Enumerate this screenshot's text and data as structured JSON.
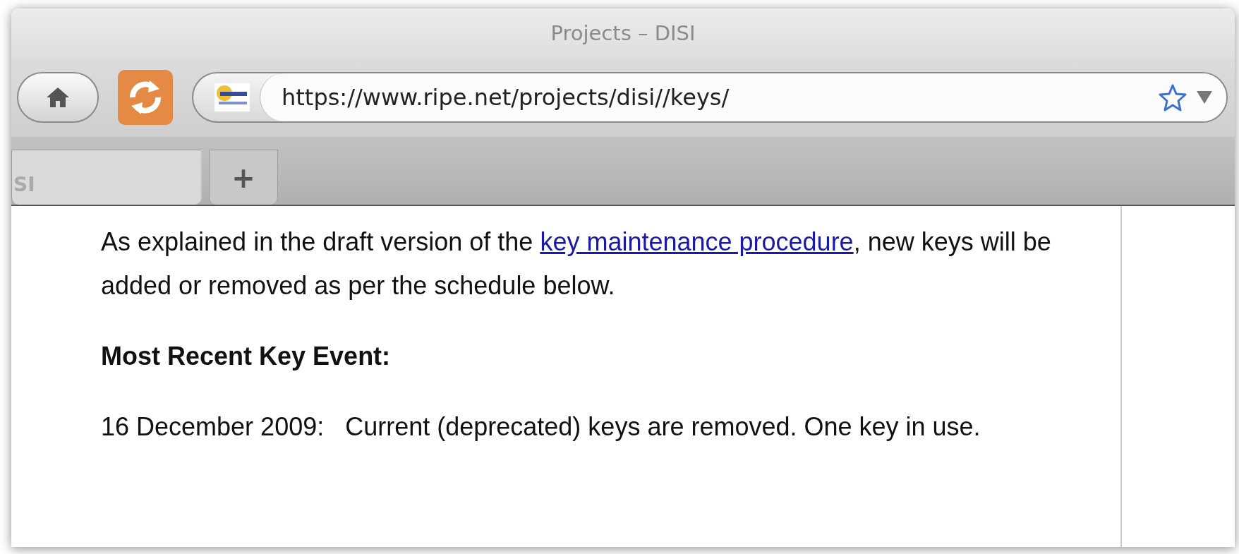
{
  "window": {
    "title": "Projects – DISI"
  },
  "toolbar": {
    "address": "https://www.ripe.net/projects/disi//keys/"
  },
  "tabs": [
    {
      "label": "SI",
      "kind": "page",
      "selected": true
    },
    {
      "label": "+",
      "kind": "new",
      "selected": false
    }
  ],
  "content": {
    "intro": {
      "before": "As explained in the draft version of the ",
      "link": "key maintenance procedure",
      "after": ", new keys will be added or removed as per the schedule below."
    },
    "heading": "Most Recent Key Event:",
    "event": "16 December 2009:   Current (deprecated) keys are removed. One key in use."
  }
}
